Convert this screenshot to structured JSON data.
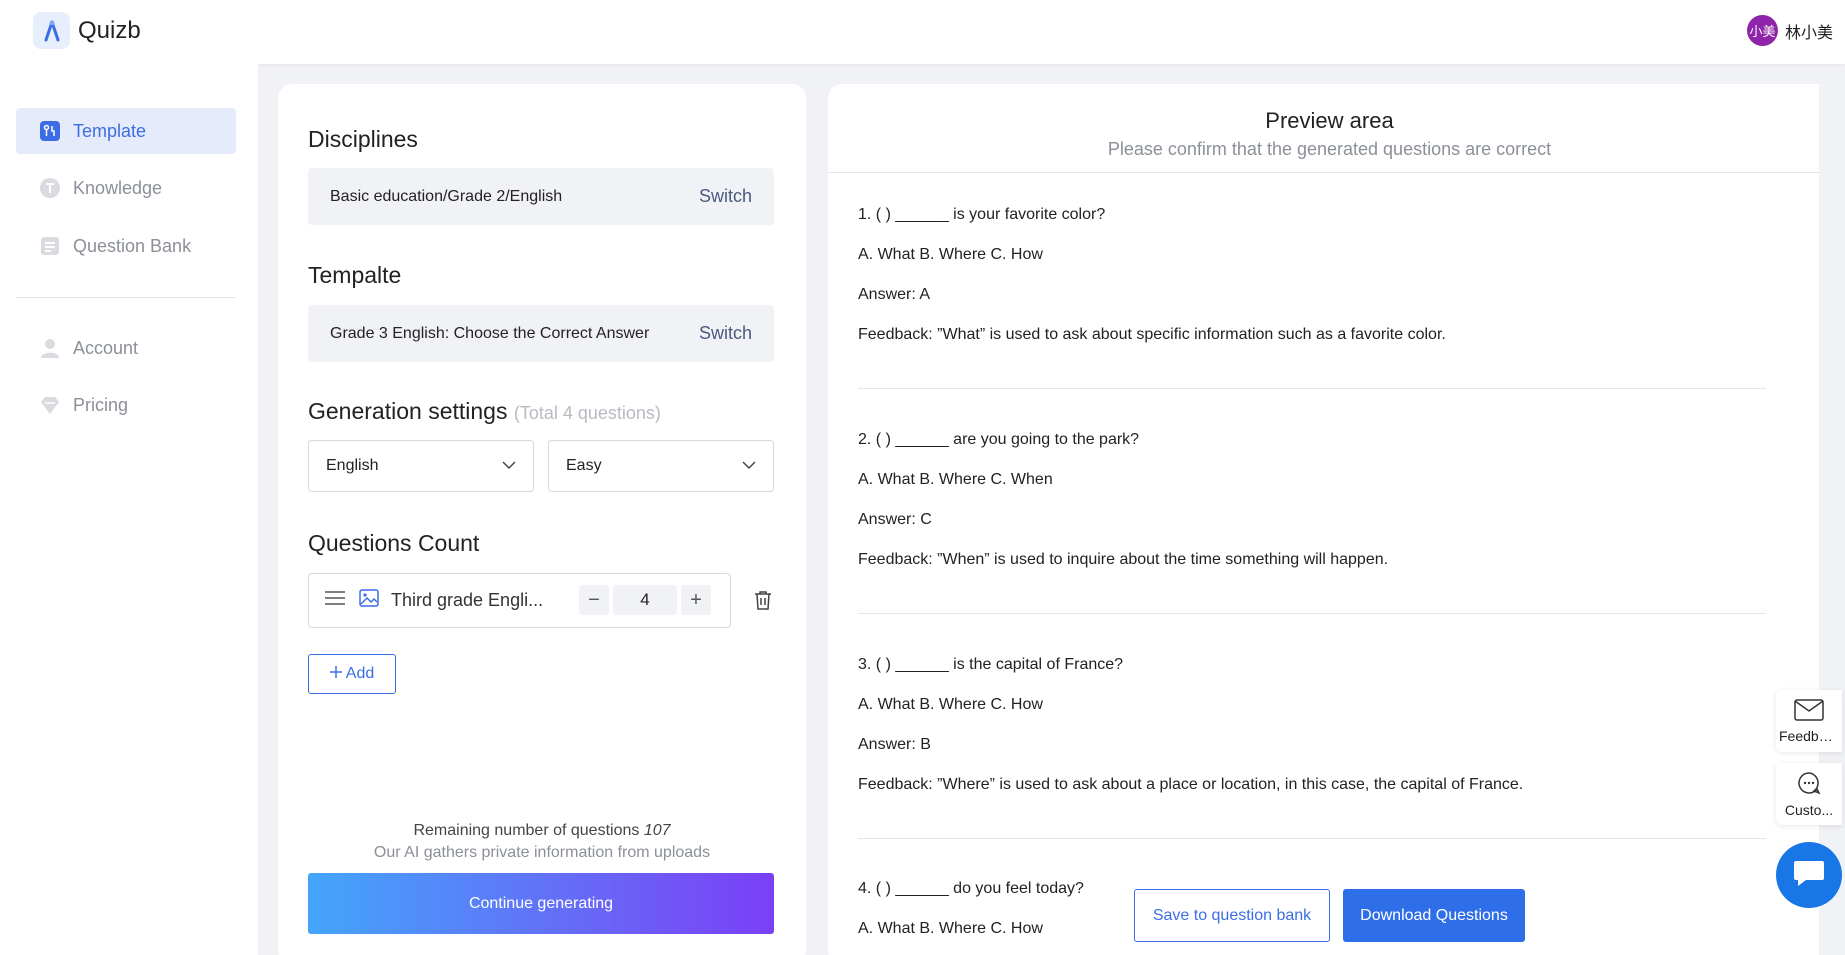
{
  "header": {
    "brand": "Quizb",
    "avatar_text": "小美",
    "username": "林小美"
  },
  "sidebar": {
    "items": [
      {
        "label": "Template",
        "icon": "template-icon",
        "active": true
      },
      {
        "label": "Knowledge",
        "icon": "knowledge-icon",
        "active": false
      },
      {
        "label": "Question Bank",
        "icon": "question-bank-icon",
        "active": false
      },
      {
        "label": "Account",
        "icon": "account-icon",
        "active": false
      },
      {
        "label": "Pricing",
        "icon": "pricing-icon",
        "active": false
      }
    ]
  },
  "form": {
    "disciplines_title": "Disciplines",
    "discipline_value": "Basic education/Grade 2/English",
    "switch_label": "Switch",
    "template_title": "Tempalte",
    "template_value": "Grade 3 English: Choose the Correct Answer",
    "generation_title": "Generation settings",
    "generation_total": "(Total 4 questions)",
    "language_select": "English",
    "difficulty_select": "Easy",
    "questions_count_title": "Questions Count",
    "question_type_name": "Third grade Engli...",
    "question_count_value": "4",
    "minus_label": "−",
    "plus_label": "+",
    "add_label": "Add",
    "remaining_label": "Remaining number of questions",
    "remaining_value": "107",
    "ai_note": "Our AI gathers private information from uploads",
    "generate_label": "Continue generating"
  },
  "preview": {
    "title": "Preview area",
    "subtitle": "Please confirm that the generated questions are correct",
    "questions": [
      {
        "question": "1. ( ) ______ is your favorite color?",
        "options": "A. What B. Where C. How",
        "answer": "Answer: A",
        "feedback": "Feedback: ”What” is used to ask about specific information such as a favorite color."
      },
      {
        "question": "2. ( ) ______ are you going to the park?",
        "options": "A. What B. Where C. When",
        "answer": "Answer: C",
        "feedback": "Feedback: ”When” is used to inquire about the time something will happen."
      },
      {
        "question": "3. ( ) ______ is the capital of France?",
        "options": "A. What B. Where C. How",
        "answer": "Answer: B",
        "feedback": "Feedback: ”Where” is used to ask about a place or location, in this case, the capital of France."
      },
      {
        "question": "4. ( ) ______ do you feel today?",
        "options": "A. What B. Where C. How"
      }
    ],
    "save_label": "Save to question bank",
    "download_label": "Download Questions"
  },
  "floating": {
    "feedback_label": "Feedback",
    "customer_label": "Custo..."
  },
  "colors": {
    "accent": "#3c6de4",
    "download_button": "#2f6ee9",
    "avatar": "#8e24aa",
    "chat_bubble": "#1976e6"
  }
}
